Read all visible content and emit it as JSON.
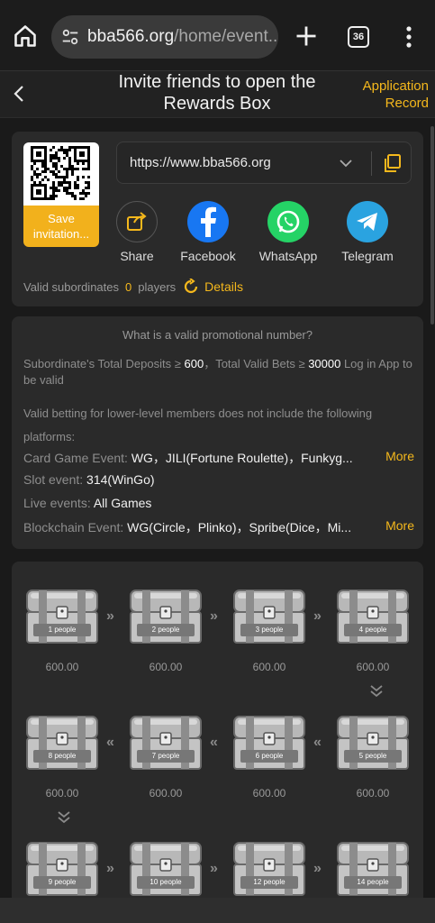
{
  "browser": {
    "url_host": "bba566.org",
    "url_path": "/home/event...",
    "tab_count": "36"
  },
  "header": {
    "title_line1": "Invite friends to open the",
    "title_line2": "Rewards Box",
    "record_link": "Application Record"
  },
  "invite": {
    "save_label_1": "Save",
    "save_label_2": "invitation...",
    "link": "https://www.bba566.org",
    "share_options": [
      {
        "label": "Share",
        "icon": "share-icon"
      },
      {
        "label": "Facebook",
        "icon": "facebook-icon"
      },
      {
        "label": "WhatsApp",
        "icon": "whatsapp-icon"
      },
      {
        "label": "Telegram",
        "icon": "telegram-icon"
      }
    ],
    "valid_label": "Valid subordinates",
    "valid_count": "0",
    "valid_unit": "players",
    "details_label": "Details"
  },
  "info": {
    "title": "What is a valid promotional number?",
    "req_prefix": "Subordinate's Total Deposits ≥ ",
    "req_deposit": "600",
    "req_mid": "，Total Valid Bets ≥ ",
    "req_bet": "30000",
    "req_suffix": " Log in App to be valid",
    "exclusion": "Valid betting for lower-level members does not include the following platforms:",
    "events": [
      {
        "label": "Card Game Event: ",
        "value": "WG，JILI(Fortune Roulette)，Funkyg...",
        "more": "More"
      },
      {
        "label": "Slot event: ",
        "value": "314(WinGo)",
        "more": ""
      },
      {
        "label": "Live events: ",
        "value": "All Games",
        "more": ""
      },
      {
        "label": "Blockchain Event: ",
        "value": "WG(Circle，Plinko)，Spribe(Dice，Mi...",
        "more": "More"
      }
    ]
  },
  "chests": [
    {
      "people": "1 people",
      "value": "600.00"
    },
    {
      "people": "2 people",
      "value": "600.00"
    },
    {
      "people": "3 people",
      "value": "600.00"
    },
    {
      "people": "4 people",
      "value": "600.00"
    },
    {
      "people": "5 people",
      "value": "600.00"
    },
    {
      "people": "6 people",
      "value": "600.00"
    },
    {
      "people": "7 people",
      "value": "600.00"
    },
    {
      "people": "8 people",
      "value": "600.00"
    },
    {
      "people": "9 people",
      "value": ""
    },
    {
      "people": "10 people",
      "value": ""
    },
    {
      "people": "12 people",
      "value": ""
    },
    {
      "people": "14 people",
      "value": ""
    }
  ],
  "colors": {
    "accent": "#f5b81c",
    "facebook": "#1877f2",
    "whatsapp": "#25d366",
    "telegram": "#2aa3e0"
  }
}
